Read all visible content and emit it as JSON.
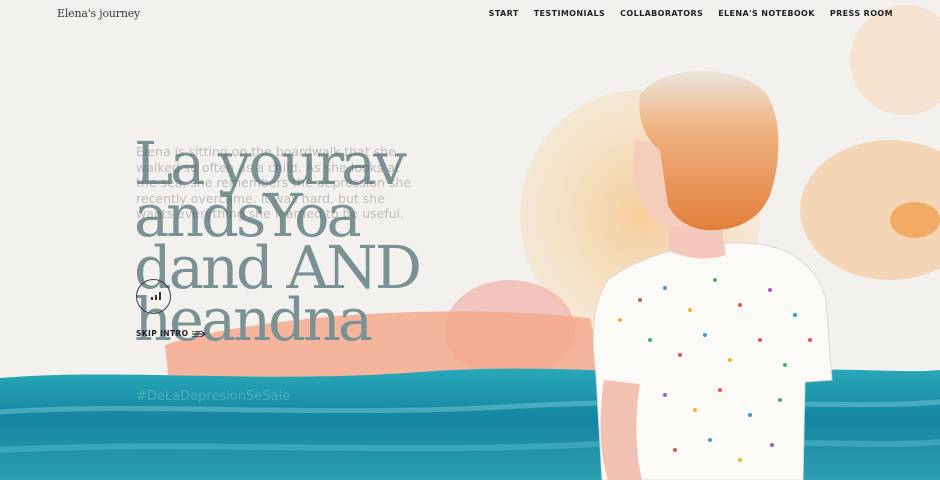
{
  "brand": {
    "logo_text": "Elena's journey"
  },
  "nav": [
    {
      "label": "START"
    },
    {
      "label": "TESTIMONIALS"
    },
    {
      "label": "COLLABORATORS"
    },
    {
      "label": "ELENA'S NOTEBOOK"
    },
    {
      "label": "PRESS ROOM"
    }
  ],
  "hero": {
    "headline": "La yourav\nandsYoa\ndand AND\nheandna",
    "intro": "Elena is sitting on the boardwalk that she walked so often as a child. As she looks at the sea, she remembers the depression she recently overcame. It was hard, but she wants everything she learned to be useful.",
    "hashtag": "#DeLaDepresionSeSale"
  },
  "controls": {
    "sound_icon": "sound-bars-icon",
    "skip_label": "SKIP INTRO",
    "skip_icon": "arrow-right-icon"
  },
  "colors": {
    "background": "#f3f1ed",
    "headline": "#7a9293",
    "sea": "#1a8fa3",
    "hair": "#e98a46"
  }
}
